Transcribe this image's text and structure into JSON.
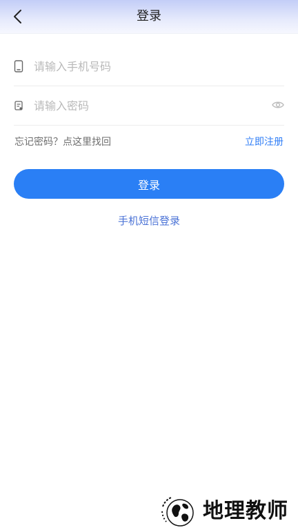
{
  "header": {
    "title": "登录",
    "back_icon": "chevron-left-icon"
  },
  "form": {
    "phone": {
      "icon": "phone-icon",
      "placeholder": "请输入手机号码",
      "value": ""
    },
    "password": {
      "icon": "password-icon",
      "placeholder": "请输入密码",
      "value": "",
      "toggle_icon": "eye-icon"
    }
  },
  "links": {
    "forgot": "忘记密码？点这里找回",
    "register": "立即注册",
    "sms_login": "手机短信登录"
  },
  "buttons": {
    "login": "登录"
  },
  "watermark": {
    "text": "地理教师"
  },
  "colors": {
    "accent": "#2a7ff5",
    "link": "#2f7df6",
    "sms_link": "#4a72d6",
    "header_gradient_top": "#c3cdf7"
  }
}
